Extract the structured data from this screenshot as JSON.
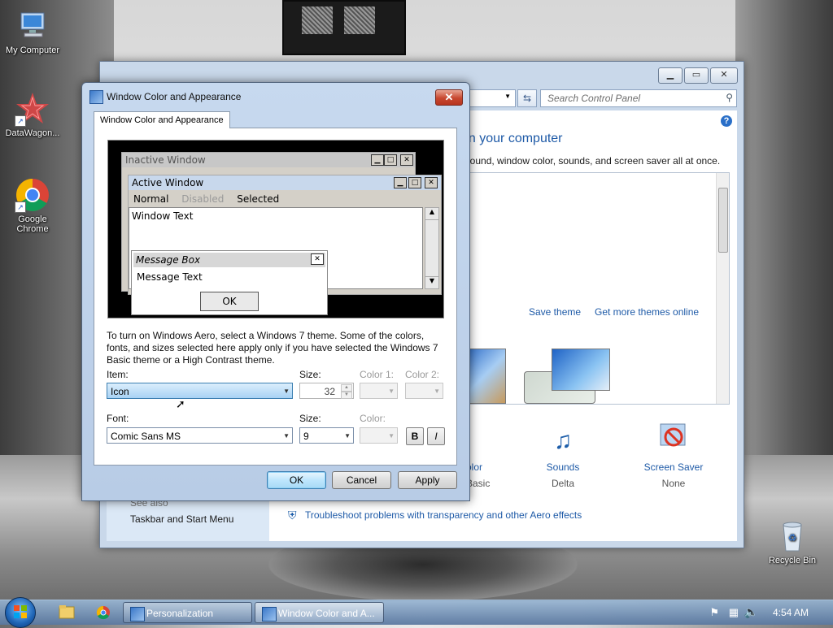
{
  "desktop": {
    "icons": [
      {
        "label": "My Computer"
      },
      {
        "label": "DataWagon..."
      },
      {
        "label": "Google Chrome"
      },
      {
        "label": "Recycle Bin"
      }
    ]
  },
  "control_panel": {
    "search_placeholder": "Search Control Panel",
    "heading": "on your computer",
    "description": "ground, window color, sounds, and screen saver all at once.",
    "save_theme": "Save theme",
    "get_more_themes": "Get more themes online",
    "see_also": "See also",
    "taskbar_link": "Taskbar and Start Menu",
    "troubleshoot_link": "Troubleshoot problems with transparency and other Aero effects",
    "bottom_items": [
      {
        "label": "olor",
        "value": "Basic"
      },
      {
        "label": "Sounds",
        "value": "Delta"
      },
      {
        "label": "Screen Saver",
        "value": "None"
      }
    ]
  },
  "dialog": {
    "title": "Window Color and Appearance",
    "tab": "Window Color and Appearance",
    "preview": {
      "inactive_title": "Inactive Window",
      "active_title": "Active Window",
      "menu": [
        "Normal",
        "Disabled",
        "Selected"
      ],
      "window_text": "Window Text",
      "msg_title": "Message Box",
      "msg_text": "Message Text",
      "msg_ok": "OK"
    },
    "info": "To turn on Windows Aero, select a Windows 7 theme.  Some of the colors, fonts, and sizes selected here apply only if you have selected the Windows 7 Basic theme or a High Contrast theme.",
    "item_label": "Item:",
    "item_value": "Icon",
    "size_label": "Size:",
    "size_value": "32",
    "color1_label": "Color 1:",
    "color2_label": "Color 2:",
    "font_label": "Font:",
    "font_value": "Comic Sans MS",
    "font_size_label": "Size:",
    "font_size_value": "9",
    "color_label": "Color:",
    "bold": "B",
    "italic": "I",
    "ok": "OK",
    "cancel": "Cancel",
    "apply": "Apply"
  },
  "taskbar": {
    "tasks": [
      {
        "label": "Personalization"
      },
      {
        "label": "Window Color and A..."
      }
    ],
    "clock": "4:54 AM"
  },
  "colors": {
    "link": "#1e5aa7",
    "dialog_close": "#c7472f",
    "selected_combo": "#a8d2f4",
    "preview_active_title": "#c8d8ec"
  }
}
